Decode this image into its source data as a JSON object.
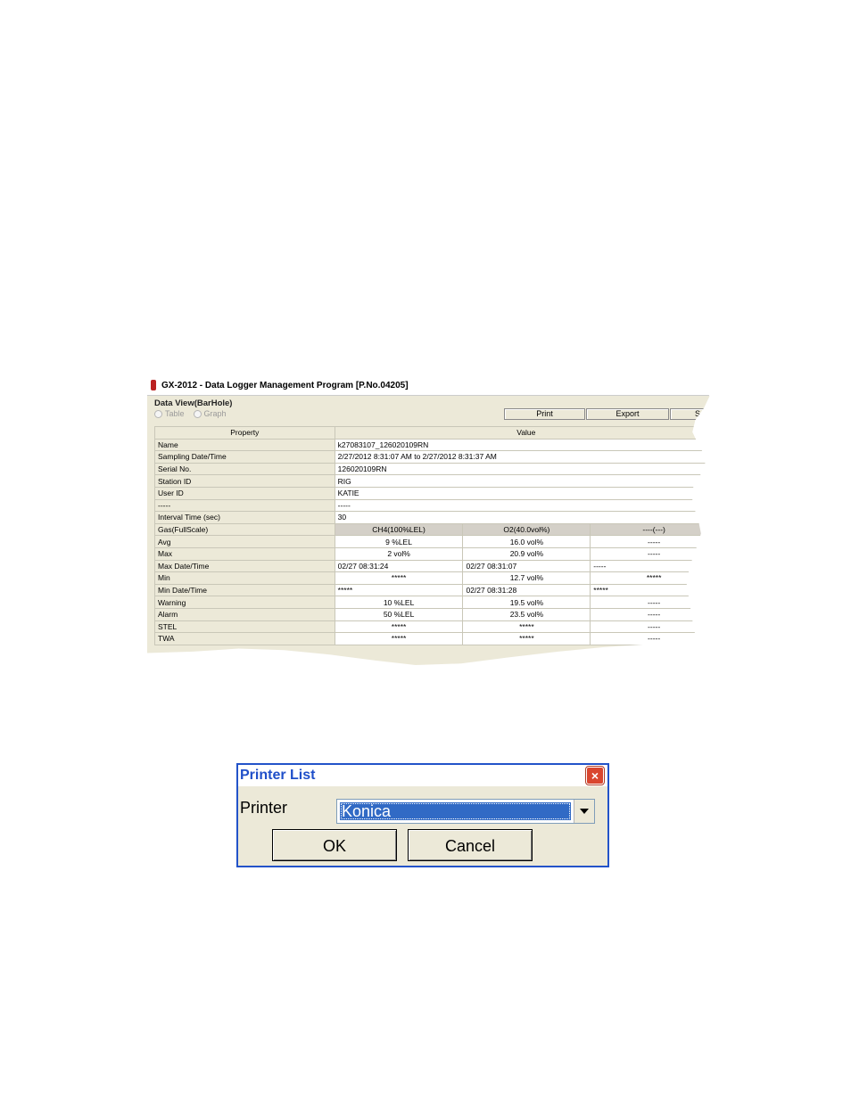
{
  "window": {
    "title": "GX-2012  - Data Logger Management Program [P.No.04205]",
    "section_title": "Data View(BarHole)",
    "view_options": [
      "Table",
      "Graph"
    ],
    "toolbar": {
      "print": "Print",
      "export": "Export",
      "partial": "S"
    }
  },
  "table": {
    "headers": {
      "property": "Property",
      "value": "Value"
    },
    "info_rows": [
      {
        "property": "Name",
        "value": "k27083107_126020109RN"
      },
      {
        "property": "Sampling Date/Time",
        "value": "2/27/2012 8:31:07 AM to 2/27/2012 8:31:37 AM"
      },
      {
        "property": "Serial No.",
        "value": "126020109RN"
      },
      {
        "property": "Station ID",
        "value": "RIG"
      },
      {
        "property": "User ID",
        "value": "KATIE"
      },
      {
        "property": "-----",
        "value": "-----"
      },
      {
        "property": "Interval Time (sec)",
        "value": "30"
      }
    ],
    "gas_row": {
      "property": "Gas(FullScale)",
      "cols": [
        "CH4(100%LEL)",
        "O2(40.0vol%)",
        "----(---)"
      ]
    },
    "gas_rows": [
      {
        "property": "Avg",
        "cols": [
          "9 %LEL",
          "16.0 vol%",
          "-----"
        ]
      },
      {
        "property": "Max",
        "cols": [
          "2 vol%",
          "20.9 vol%",
          "-----"
        ]
      },
      {
        "property": "Max Date/Time",
        "cols": [
          "02/27 08:31:24",
          "02/27 08:31:07",
          "-----"
        ]
      },
      {
        "property": "Min",
        "cols": [
          "*****",
          "12.7 vol%",
          "*****"
        ]
      },
      {
        "property": "Min Date/Time",
        "cols": [
          "*****",
          "02/27 08:31:28",
          "*****"
        ]
      },
      {
        "property": "Warning",
        "cols": [
          "10 %LEL",
          "19.5 vol%",
          "-----"
        ]
      },
      {
        "property": "Alarm",
        "cols": [
          "50 %LEL",
          "23.5 vol%",
          "-----"
        ]
      },
      {
        "property": "STEL",
        "cols": [
          "*****",
          "*****",
          "-----"
        ]
      },
      {
        "property": "TWA",
        "cols": [
          "*****",
          "*****",
          "-----"
        ]
      }
    ]
  },
  "dialog": {
    "title": "Printer List",
    "close": "×",
    "printer_label": "Printer",
    "printer_value": "Konica",
    "ok": "OK",
    "cancel": "Cancel"
  }
}
